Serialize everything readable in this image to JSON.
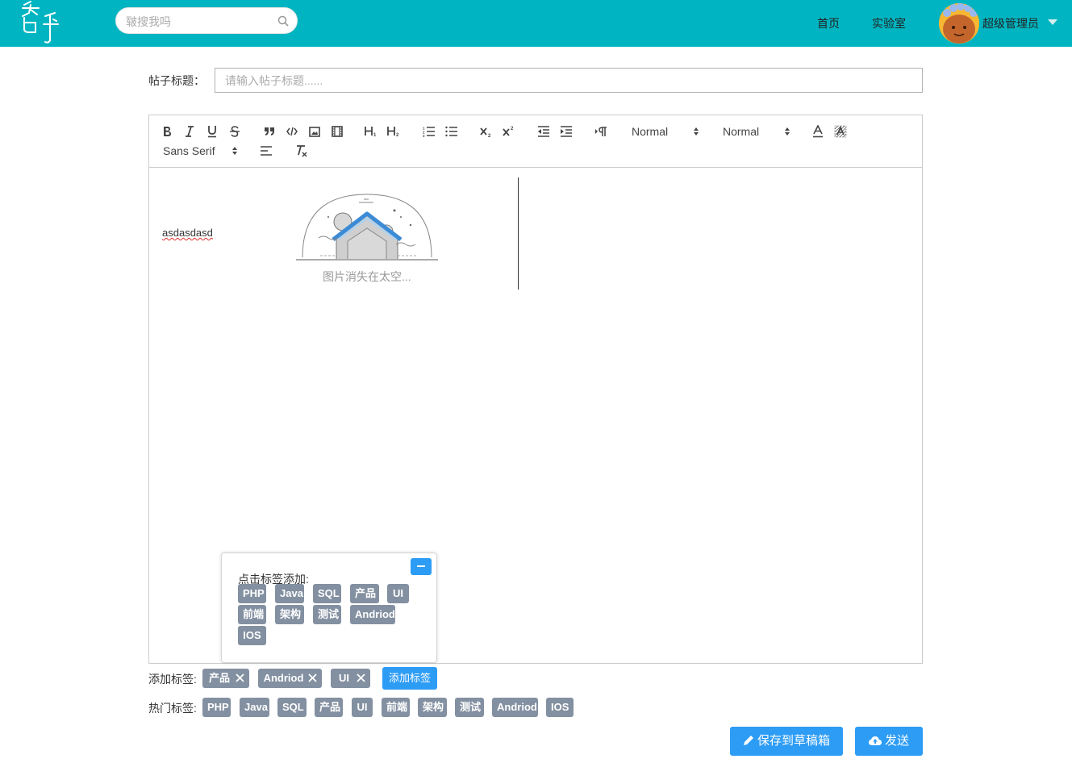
{
  "header": {
    "logo_text": "智乎",
    "search_placeholder": "皲搜我吗",
    "nav": [
      "首页",
      "实验室"
    ],
    "user_name": "超级管理员",
    "bg_color": "#00b5c1"
  },
  "post": {
    "title_label": "帖子标题：",
    "title_placeholder": "请输入帖子标题......"
  },
  "toolbar": {
    "header_picker": "Normal",
    "size_picker": "Normal",
    "font_picker": "Sans Serif",
    "icons": [
      "bold-icon",
      "italic-icon",
      "underline-icon",
      "strike-icon",
      "blockquote-icon",
      "code-block-icon",
      "image-icon",
      "video-icon",
      "h1-icon",
      "h2-icon",
      "ordered-list-icon",
      "bullet-list-icon",
      "subscript-icon",
      "superscript-icon",
      "outdent-icon",
      "indent-icon",
      "rtl-direction-icon",
      "font-color-icon",
      "background-color-icon",
      "align-icon",
      "clean-format-icon"
    ]
  },
  "content": {
    "text": "asdasdasd",
    "broken_image_caption": "图片消失在太空..."
  },
  "tag_popup": {
    "hint": "点击标签添加:",
    "tags": [
      "PHP",
      "Java",
      "SQL",
      "产品",
      "UI",
      "前端",
      "架构",
      "测试",
      "Andriod",
      "IOS"
    ]
  },
  "added_tags": {
    "label": "添加标签:",
    "tags": [
      "产品",
      "Andriod",
      "UI"
    ],
    "add_button": "添加标签"
  },
  "hot_tags": {
    "label": "热门标签:",
    "tags": [
      "PHP",
      "Java",
      "SQL",
      "产品",
      "UI",
      "前端",
      "架构",
      "测试",
      "Andriod",
      "IOS"
    ]
  },
  "actions": {
    "save_draft": "保存到草稿箱",
    "send": "发送"
  },
  "colors": {
    "accent": "#2d9cf5",
    "tag_bg": "#8390a1"
  }
}
